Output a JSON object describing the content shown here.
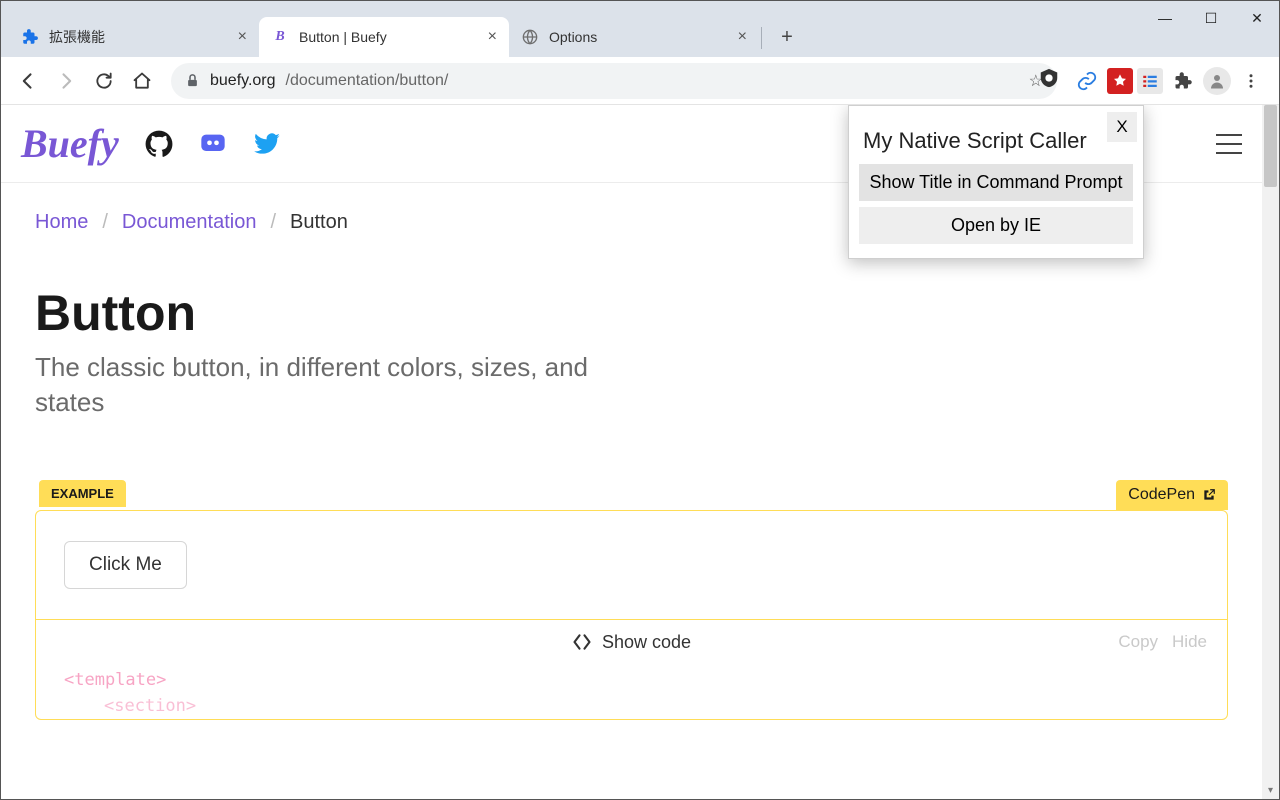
{
  "window": {
    "minimize": "—",
    "maximize": "☐",
    "close": "✕"
  },
  "tabs": [
    {
      "title": "拡張機能",
      "icon": "puzzle-icon",
      "icon_color": "#1a73e8"
    },
    {
      "title": "Button | Buefy",
      "icon": "B",
      "icon_color": "#7957d5"
    },
    {
      "title": "Options",
      "icon": "globe-icon",
      "icon_color": "#6e6e6e"
    }
  ],
  "newtab": "+",
  "omnibox": {
    "lock": "🔒",
    "host": "buefy.org",
    "path": "/documentation/button/",
    "star": "☆"
  },
  "ext_icons": [
    "link-icon",
    "pdf-icon",
    "list-icon",
    "puzzle-icon",
    "profile-icon",
    "menu-dots-icon"
  ],
  "ublock": "⬣",
  "header": {
    "logo": "Buefy",
    "social": [
      "github-icon",
      "discord-icon",
      "twitter-icon"
    ]
  },
  "breadcrumb": {
    "home": "Home",
    "docs": "Documentation",
    "current": "Button",
    "sep": "/"
  },
  "title": {
    "heading": "Button",
    "sub": "The classic button, in different colors, sizes, and states"
  },
  "example": {
    "label": "EXAMPLE",
    "codepen": "CodePen",
    "button": "Click Me",
    "showcode": "Show code",
    "copy": "Copy",
    "hide": "Hide",
    "code_line1": "<template>",
    "code_line2": "<section>"
  },
  "popup": {
    "close": "X",
    "title": "My Native Script Caller",
    "btn1": "Show Title in Command Prompt",
    "btn2": "Open by IE"
  }
}
